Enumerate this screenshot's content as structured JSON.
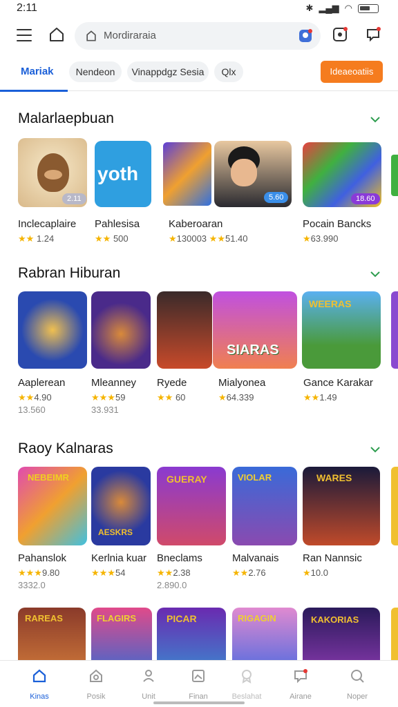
{
  "status": {
    "time": "2:11"
  },
  "search": {
    "placeholder": "Mordiraraia"
  },
  "filters": {
    "active_tab": "Mariak",
    "chips": [
      "Nendeon",
      "Vinappdgz Sesia",
      "Qlx"
    ],
    "action_label": "Ideaeoatiis"
  },
  "sections": [
    {
      "title": "Malarlaepbuan",
      "items": [
        {
          "name": "Inclecaplaire",
          "rating": "1.24",
          "badge": "2.11"
        },
        {
          "name": "Pahlesisa",
          "rating": "500",
          "thumb_text": "yoth"
        },
        {
          "name": "Kaberoaran",
          "rating": "130003",
          "rating2": "51.40",
          "badge": "5.60"
        },
        {
          "name": "Pocain Bancks",
          "rating": "63.990",
          "badge": "18.60"
        }
      ]
    },
    {
      "title": "Rabran Hiburan",
      "items": [
        {
          "name": "Aaplerean",
          "rating": "4.90",
          "extra": "13.560"
        },
        {
          "name": "Mleanney",
          "rating": "59",
          "extra": "33.931"
        },
        {
          "name": "Ryede",
          "rating": "60"
        },
        {
          "name": "Mialyonea",
          "rating": "64.339",
          "thumb_text": "SIARAS"
        },
        {
          "name": "Gance Karakar",
          "rating": "1.49",
          "thumb_text": "WEERAS"
        }
      ]
    },
    {
      "title": "Raoy Kalnaras",
      "items": [
        {
          "name": "Pahanslok",
          "rating": "9.80",
          "extra": "3332.0",
          "thumb_text": "NEBEIMR"
        },
        {
          "name": "Kerlnia kuar",
          "rating": "54",
          "thumb_text": "AESKRS"
        },
        {
          "name": "Bneclams",
          "rating": "2.38",
          "extra": "2.890.0",
          "thumb_text": "GUERAY"
        },
        {
          "name": "Malvanais",
          "rating": "2.76",
          "thumb_text": "VIOLAR"
        },
        {
          "name": "Ran Nannsic",
          "rating": "10.0",
          "thumb_text": "WARES"
        }
      ]
    },
    {
      "items": [
        {
          "thumb_text": "RAREAS"
        },
        {
          "thumb_text": "FLAGIRS"
        },
        {
          "thumb_text": "PICAR"
        },
        {
          "thumb_text": "RIGAGIN"
        },
        {
          "thumb_text": "KAKORIAS"
        }
      ]
    }
  ],
  "nav": [
    "Kinas",
    "Posik",
    "Unit",
    "Finan",
    "Beslahat",
    "Airane",
    "Noper"
  ],
  "colors": {
    "accent": "#1a5fd8",
    "orange": "#f57c1f",
    "star": "#f5b400",
    "chevron": "#2e9d4f"
  }
}
